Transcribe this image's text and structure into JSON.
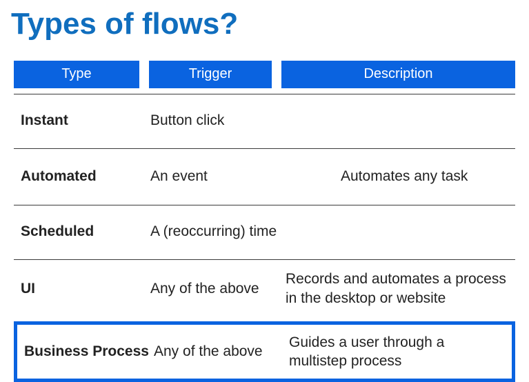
{
  "title": "Types of flows?",
  "headers": {
    "c1": "Type",
    "c2": "Trigger",
    "c3": "Description"
  },
  "rows": [
    {
      "type": "Instant",
      "trigger": "Button click",
      "description": ""
    },
    {
      "type": "Automated",
      "trigger": "An event",
      "description": "Automates any task"
    },
    {
      "type": "Scheduled",
      "trigger": "A (reoccurring) time",
      "description": ""
    },
    {
      "type": "UI",
      "trigger": "Any of the above",
      "description": "Records and automates a process in the desktop or website"
    },
    {
      "type": "Business Process",
      "trigger": "Any of the above",
      "description": "Guides a user through a multistep process"
    }
  ]
}
